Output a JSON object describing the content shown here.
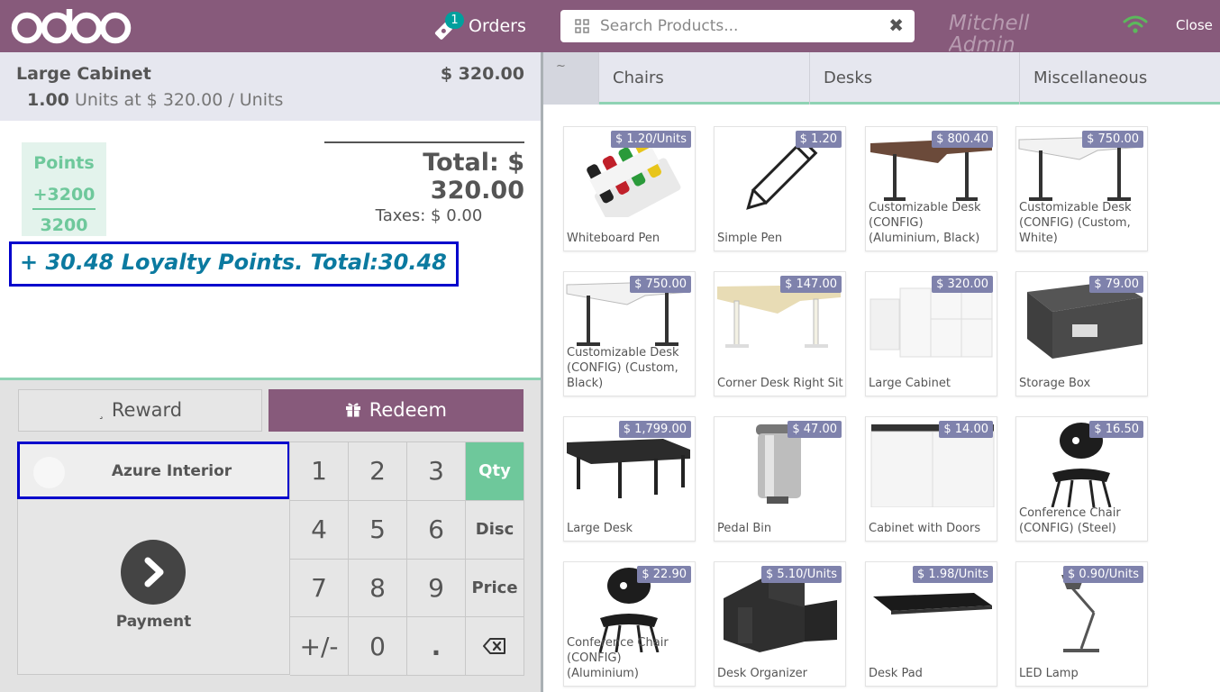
{
  "header": {
    "orders_count": "1",
    "orders_label": "Orders",
    "search_placeholder": "Search Products...",
    "user": "Mitchell Admin",
    "close_label": "Close"
  },
  "order": {
    "line_name": "Large Cabinet",
    "line_price": "$ 320.00",
    "line_qty": "1.00",
    "line_unit_text": "Units at $ 320.00 / Units",
    "points_label": "Points",
    "points_added": "+3200",
    "points_total": "3200",
    "total": "Total: $ 320.00",
    "taxes": "Taxes: $ 0.00",
    "loyalty": "+ 30.48 Loyalty Points. Total:30.48"
  },
  "controls": {
    "reward_label": "Reward",
    "reward_icon_glyph": "¸",
    "redeem_label": "Redeem",
    "customer": "Azure Interior",
    "payment": "Payment",
    "keys": [
      "1",
      "2",
      "3",
      "Qty",
      "4",
      "5",
      "6",
      "Disc",
      "7",
      "8",
      "9",
      "Price",
      "+/-",
      "0",
      ".",
      "⌫"
    ],
    "active_mode": "Qty"
  },
  "categories": {
    "home_glyph": "~",
    "items": [
      "Chairs",
      "Desks",
      "Miscellaneous"
    ]
  },
  "products": [
    {
      "name": "Whiteboard Pen",
      "price": "$ 1.20/Units",
      "icon": "whiteboard-pen"
    },
    {
      "name": "Simple Pen",
      "price": "$ 1.20",
      "icon": "pen"
    },
    {
      "name": "Customizable Desk (CONFIG) (Aluminium, Black)",
      "price": "$ 800.40",
      "icon": "desk-brown"
    },
    {
      "name": "Customizable Desk (CONFIG) (Custom, White)",
      "price": "$ 750.00",
      "icon": "desk-white"
    },
    {
      "name": "Customizable Desk (CONFIG) (Custom, Black)",
      "price": "$ 750.00",
      "icon": "desk-white"
    },
    {
      "name": "Corner Desk Right Sit",
      "price": "$ 147.00",
      "icon": "corner-desk"
    },
    {
      "name": "Large Cabinet",
      "price": "$ 320.00",
      "icon": "cabinet"
    },
    {
      "name": "Storage Box",
      "price": "$ 79.00",
      "icon": "storage-box"
    },
    {
      "name": "Large Desk",
      "price": "$ 1,799.00",
      "icon": "large-desk"
    },
    {
      "name": "Pedal Bin",
      "price": "$ 47.00",
      "icon": "pedal-bin"
    },
    {
      "name": "Cabinet with Doors",
      "price": "$ 14.00",
      "icon": "cabinet-doors"
    },
    {
      "name": "Conference Chair (CONFIG) (Steel)",
      "price": "$ 16.50",
      "icon": "chair"
    },
    {
      "name": "Conference Chair (CONFIG) (Aluminium)",
      "price": "$ 22.90",
      "icon": "chair"
    },
    {
      "name": "Desk Organizer",
      "price": "$ 5.10/Units",
      "icon": "desk-organizer"
    },
    {
      "name": "Desk Pad",
      "price": "$ 1.98/Units",
      "icon": "desk-pad"
    },
    {
      "name": "LED Lamp",
      "price": "$ 0.90/Units",
      "icon": "lamp"
    }
  ],
  "colors": {
    "brand": "#875a7b",
    "accent_green": "#6ec89b",
    "price_tag": "#7f82ac",
    "highlight_border": "#0000cc",
    "badge": "#00a09d"
  }
}
